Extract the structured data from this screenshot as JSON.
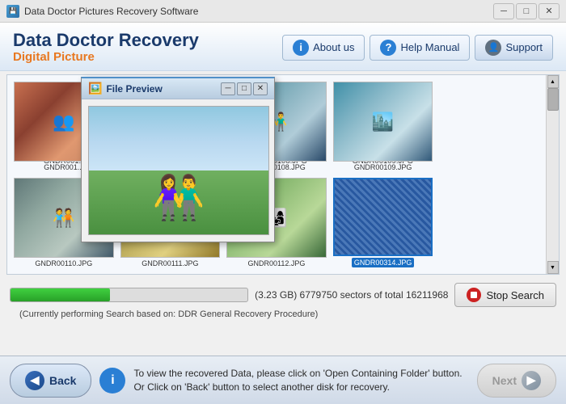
{
  "window": {
    "title": "Data Doctor Pictures Recovery Software",
    "icon": "💾"
  },
  "header": {
    "app_name": "Data Doctor Recovery",
    "subtitle": "Digital Picture",
    "buttons": {
      "about_us": "About us",
      "help_manual": "Help Manual",
      "support": "Support"
    }
  },
  "photos": [
    {
      "id": "p1",
      "label": "GNDR001...",
      "selected": false,
      "style": "thumb-1"
    },
    {
      "id": "p2",
      "label": "GNDR00108.JPG",
      "selected": false,
      "style": "thumb-2"
    },
    {
      "id": "p3",
      "label": "GNDR00109.JPG",
      "selected": false,
      "style": "thumb-3"
    },
    {
      "id": "p4",
      "label": "GNDR00110.JPG",
      "selected": false,
      "style": "thumb-6"
    },
    {
      "id": "p5",
      "label": "GNDR00111.JPG",
      "selected": false,
      "style": "thumb-7"
    },
    {
      "id": "p6",
      "label": "GNDR00112.JPG",
      "selected": false,
      "style": "thumb-4"
    },
    {
      "id": "p7",
      "label": "GNDR00314.JPG",
      "selected": true,
      "style": "thumb-5"
    }
  ],
  "progress": {
    "size_text": "(3.23 GB) 6779750  sectors of total 16211968",
    "fill_percent": 42,
    "status_text": "(Currently performing Search based on:  DDR General Recovery Procedure)",
    "stop_button": "Stop Search"
  },
  "file_preview": {
    "title": "File Preview",
    "visible": true
  },
  "bottom": {
    "back_label": "Back",
    "next_label": "Next",
    "info_text": "To view the recovered Data, please click on 'Open Containing Folder' button. Or Click on 'Back' button to select another disk for recovery."
  },
  "titlebar_controls": {
    "minimize": "─",
    "maximize": "□",
    "close": "✕"
  }
}
